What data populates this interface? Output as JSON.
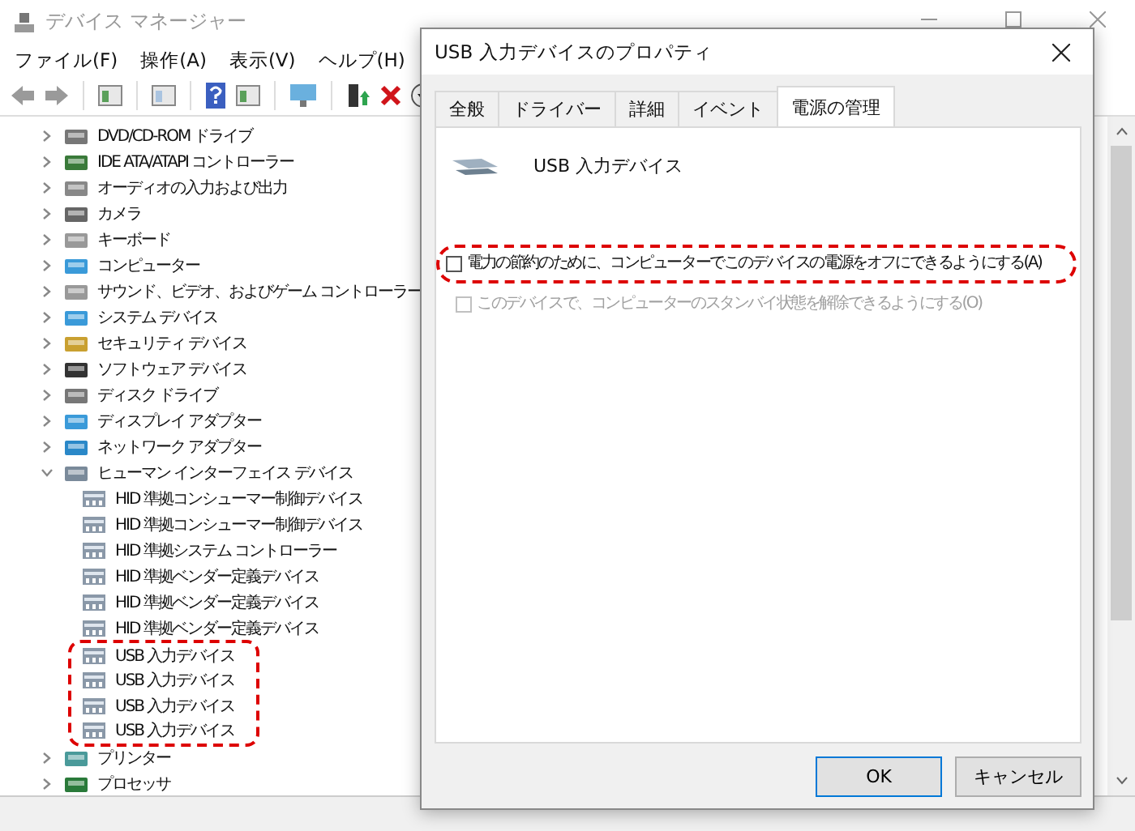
{
  "main_window": {
    "title": "デバイス マネージャー",
    "menu": [
      "ファイル(F)",
      "操作(A)",
      "表示(V)",
      "ヘルプ(H)"
    ],
    "tree": [
      {
        "label": "DVD/CD-ROM ドライブ",
        "expanded": false
      },
      {
        "label": "IDE ATA/ATAPI コントローラー",
        "expanded": false
      },
      {
        "label": "オーディオの入力および出力",
        "expanded": false
      },
      {
        "label": "カメラ",
        "expanded": false
      },
      {
        "label": "キーボード",
        "expanded": false
      },
      {
        "label": "コンピューター",
        "expanded": false
      },
      {
        "label": "サウンド、ビデオ、およびゲーム コントローラー",
        "expanded": false
      },
      {
        "label": "システム デバイス",
        "expanded": false
      },
      {
        "label": "セキュリティ デバイス",
        "expanded": false
      },
      {
        "label": "ソフトウェア デバイス",
        "expanded": false
      },
      {
        "label": "ディスク ドライブ",
        "expanded": false
      },
      {
        "label": "ディスプレイ アダプター",
        "expanded": false
      },
      {
        "label": "ネットワーク アダプター",
        "expanded": false
      },
      {
        "label": "ヒューマン インターフェイス デバイス",
        "expanded": true,
        "children": [
          {
            "label": "HID 準拠コンシューマー制御デバイス",
            "highlighted": false
          },
          {
            "label": "HID 準拠コンシューマー制御デバイス",
            "highlighted": false
          },
          {
            "label": "HID 準拠システム コントローラー",
            "highlighted": false
          },
          {
            "label": "HID 準拠ベンダー定義デバイス",
            "highlighted": false
          },
          {
            "label": "HID 準拠ベンダー定義デバイス",
            "highlighted": false
          },
          {
            "label": "HID 準拠ベンダー定義デバイス",
            "highlighted": false
          },
          {
            "label": "USB 入力デバイス",
            "highlighted": true
          },
          {
            "label": "USB 入力デバイス",
            "highlighted": true
          },
          {
            "label": "USB 入力デバイス",
            "highlighted": true
          },
          {
            "label": "USB 入力デバイス",
            "highlighted": true
          }
        ]
      },
      {
        "label": "プリンター",
        "expanded": false
      },
      {
        "label": "プロセッサ",
        "expanded": false
      }
    ]
  },
  "dialog": {
    "title": "USB 入力デバイスのプロパティ",
    "tabs": [
      {
        "label": "全般",
        "selected": false
      },
      {
        "label": "ドライバー",
        "selected": false
      },
      {
        "label": "詳細",
        "selected": false
      },
      {
        "label": "イベント",
        "selected": false
      },
      {
        "label": "電源の管理",
        "selected": true
      }
    ],
    "device_name": "USB 入力デバイス",
    "options": [
      {
        "label": "電力の節約のために、コンピューターでこのデバイスの電源をオフにできるようにする(A)",
        "checked": false,
        "disabled": false,
        "highlighted": true
      },
      {
        "label": "このデバイスで、コンピューターのスタンバイ状態を解除できるようにする(O)",
        "checked": false,
        "disabled": true,
        "highlighted": false
      }
    ],
    "buttons": [
      {
        "label": "OK",
        "default": true
      },
      {
        "label": "キャンセル",
        "default": false
      }
    ]
  }
}
